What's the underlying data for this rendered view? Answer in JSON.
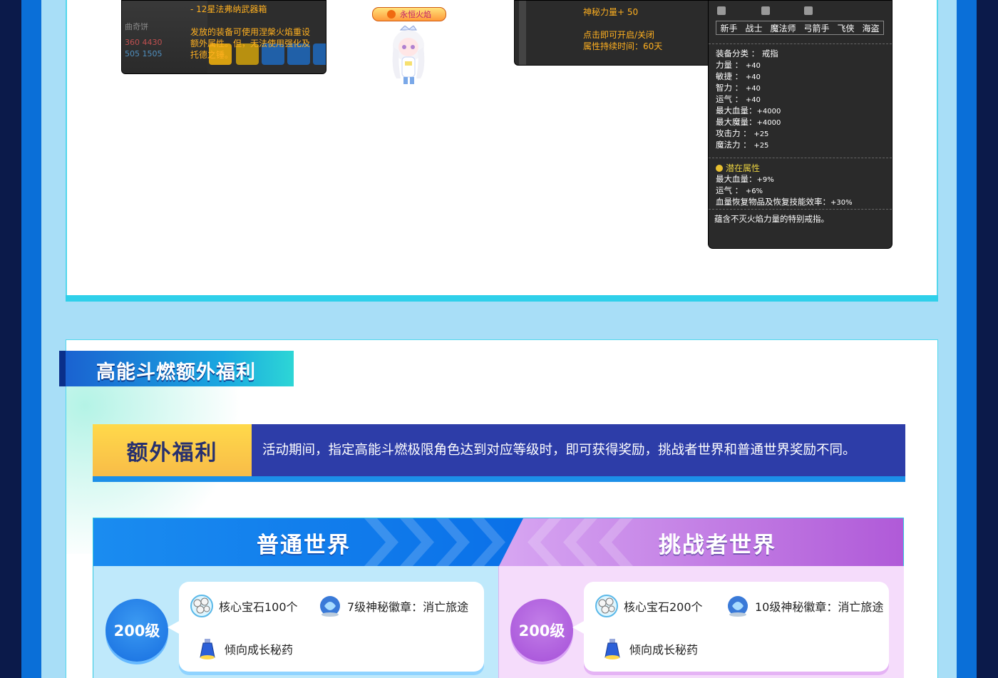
{
  "tooltip_left": {
    "lines": [
      "- 12星法弗纳武器箱",
      "",
      "发放的装备可使用涅槃火焰重设",
      "额外属性。但，无法使用强化及",
      "托德之锤。"
    ],
    "ghost": {
      "name": "曲奇饼",
      "row1": "360 4430",
      "row2": "505 1505"
    }
  },
  "character": {
    "badge": "永恒火焰"
  },
  "tooltip_mid": {
    "lines": [
      "神秘力量+ 50",
      "",
      "点击即可开启/关闭",
      "属性持续时间：60天"
    ]
  },
  "tooltip_ring": {
    "jobs": [
      "新手",
      "战士",
      "魔法师",
      "弓箭手",
      "飞侠",
      "海盗"
    ],
    "category_label": "装备分类 ：",
    "category_value": "戒指",
    "stats": [
      {
        "label": "力量 ：",
        "value": "+40"
      },
      {
        "label": "敏捷 ：",
        "value": "+40"
      },
      {
        "label": "智力 ：",
        "value": "+40"
      },
      {
        "label": "运气 ：",
        "value": "+40"
      },
      {
        "label": "最大血量：",
        "value": "+4000"
      },
      {
        "label": "最大魔量：",
        "value": "+4000"
      },
      {
        "label": "攻击力 ：",
        "value": "+25"
      },
      {
        "label": "魔法力 ：",
        "value": "+25"
      }
    ],
    "potential_title": "潜在属性",
    "potential": [
      {
        "label": "最大血量：",
        "value": "+9%"
      },
      {
        "label": "运气 ：",
        "value": "+6%"
      },
      {
        "label": "血量恢复物品及恢复技能效率：",
        "value": "+30%"
      }
    ],
    "description": "蕴含不灭火焰力量的特别戒指。"
  },
  "section": {
    "title": "高能斗燃额外福利",
    "bonus_tag": "额外福利",
    "bonus_text": "活动期间，指定高能斗燃极限角色达到对应等级时，即可获得奖励，挑战者世界和普通世界奖励不同。"
  },
  "worlds": {
    "normal": {
      "title": "普通世界",
      "level": "200级",
      "items": [
        {
          "icon": "core-gem-icon",
          "label": "核心宝石100个"
        },
        {
          "icon": "arcane-symbol-icon",
          "label": "7级神秘徽章：消亡旅途"
        },
        {
          "icon": "potion-icon",
          "label": "倾向成长秘药"
        }
      ]
    },
    "challenge": {
      "title": "挑战者世界",
      "level": "200级",
      "items": [
        {
          "icon": "core-gem-icon",
          "label": "核心宝石200个"
        },
        {
          "icon": "arcane-symbol-icon",
          "label": "10级神秘徽章：消亡旅途"
        },
        {
          "icon": "potion-icon",
          "label": "倾向成长秘药"
        }
      ]
    }
  },
  "colors": {
    "frame": "#0a6fd8",
    "page_bg": "#a8def7",
    "normal_accent": "#1a8cf0",
    "challenge_accent": "#b05ad8",
    "bonus_bar": "#2d3da8",
    "bonus_tag": "#ffd94a"
  }
}
